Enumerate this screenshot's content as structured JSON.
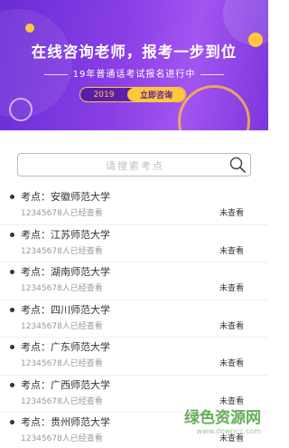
{
  "banner": {
    "title": "在线咨询老师，报考一步到位",
    "subtitle": "19年普通话考试报名进行中",
    "year": "2019",
    "cta": "立即咨询"
  },
  "search": {
    "placeholder": "请搜索考点",
    "icon": "search-icon"
  },
  "list": [
    {
      "title": "考点：安徽师范大学",
      "count": "12345678人已经查看",
      "status": "未查看"
    },
    {
      "title": "考点：江苏师范大学",
      "count": "12345678人已经查看",
      "status": "未查看"
    },
    {
      "title": "考点：湖南师范大学",
      "count": "12345678人已经查看",
      "status": "未查看"
    },
    {
      "title": "考点：四川师范大学",
      "count": "12345678人已经查看",
      "status": "未查看"
    },
    {
      "title": "考点：广东师范大学",
      "count": "12345678人已经查看",
      "status": "未查看"
    },
    {
      "title": "考点：广西师范大学",
      "count": "12345678人已经查看",
      "status": "未查看"
    },
    {
      "title": "考点：贵州师范大学",
      "count": "12345678人已经查看",
      "status": "未查看"
    }
  ],
  "watermark": {
    "text": "绿色资源网",
    "url": "www.downcc.com"
  },
  "colors": {
    "banner_purple": "#8a3fe6",
    "accent_yellow": "#ffc83a",
    "watermark_green": "#49a13a"
  }
}
